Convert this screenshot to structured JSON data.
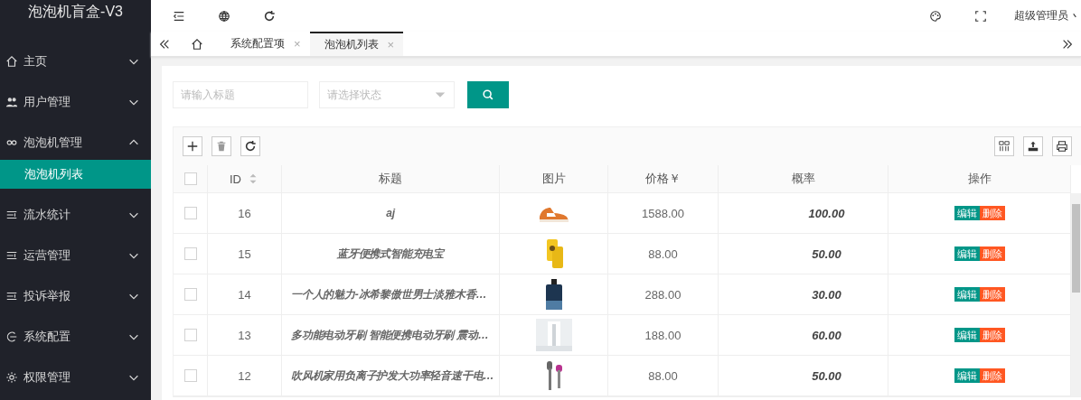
{
  "sidebar": {
    "title": "泡泡机盲盒-V3",
    "items": [
      {
        "label": "主页",
        "expanded": false,
        "selected": false
      },
      {
        "label": "用户管理",
        "expanded": false,
        "selected": false
      },
      {
        "label": "泡泡机管理",
        "expanded": true,
        "selected": false,
        "children": [
          {
            "label": "泡泡机列表",
            "selected": true
          }
        ]
      },
      {
        "label": "流水统计",
        "expanded": false,
        "selected": false
      },
      {
        "label": "运营管理",
        "expanded": false,
        "selected": false
      },
      {
        "label": "投诉举报",
        "expanded": false,
        "selected": false
      },
      {
        "label": "系统配置",
        "expanded": false,
        "selected": false
      },
      {
        "label": "权限管理",
        "expanded": false,
        "selected": false
      }
    ]
  },
  "header": {
    "user": "超级管理员"
  },
  "tabs": [
    {
      "kind": "home",
      "selected": false
    },
    {
      "kind": "page",
      "label": "系统配置项",
      "close": "×",
      "selected": false
    },
    {
      "kind": "page",
      "label": "泡泡机列表",
      "close": "×",
      "selected": true
    }
  ],
  "search": {
    "title_placeholder": "请输入标题",
    "status_placeholder": "请选择状态"
  },
  "table": {
    "header_checked": false,
    "columns": [
      "ID",
      "标题",
      "图片",
      "价格￥",
      "概率",
      "操作"
    ],
    "rows": [
      {
        "checked": false,
        "id": "16",
        "title": "aj",
        "image": {
          "kind": "picture"
        },
        "price": "1588.00",
        "probability": "100.00",
        "actions": [
          "编辑",
          "删除"
        ]
      },
      {
        "checked": false,
        "id": "15",
        "title": "蓝牙便携式智能充电宝",
        "image": {
          "kind": "picture"
        },
        "price": "88.00",
        "probability": "50.00",
        "actions": [
          "编辑",
          "删除"
        ]
      },
      {
        "checked": false,
        "id": "14",
        "title": "一个人的魅力-冰希黎傲世男士淡雅木香…",
        "image": {
          "kind": "picture"
        },
        "price": "288.00",
        "probability": "30.00",
        "actions": [
          "编辑",
          "删除"
        ]
      },
      {
        "checked": false,
        "id": "13",
        "title": "多功能电动牙刷 智能便携电动牙刷 震动…",
        "image": {
          "kind": "picture"
        },
        "price": "188.00",
        "probability": "60.00",
        "actions": [
          "编辑",
          "删除"
        ]
      },
      {
        "checked": false,
        "id": "12",
        "title": "吹风机家用负离子护发大功率轻音速干电…",
        "image": {
          "kind": "picture"
        },
        "price": "88.00",
        "probability": "50.00",
        "actions": [
          "编辑",
          "删除"
        ]
      }
    ]
  }
}
